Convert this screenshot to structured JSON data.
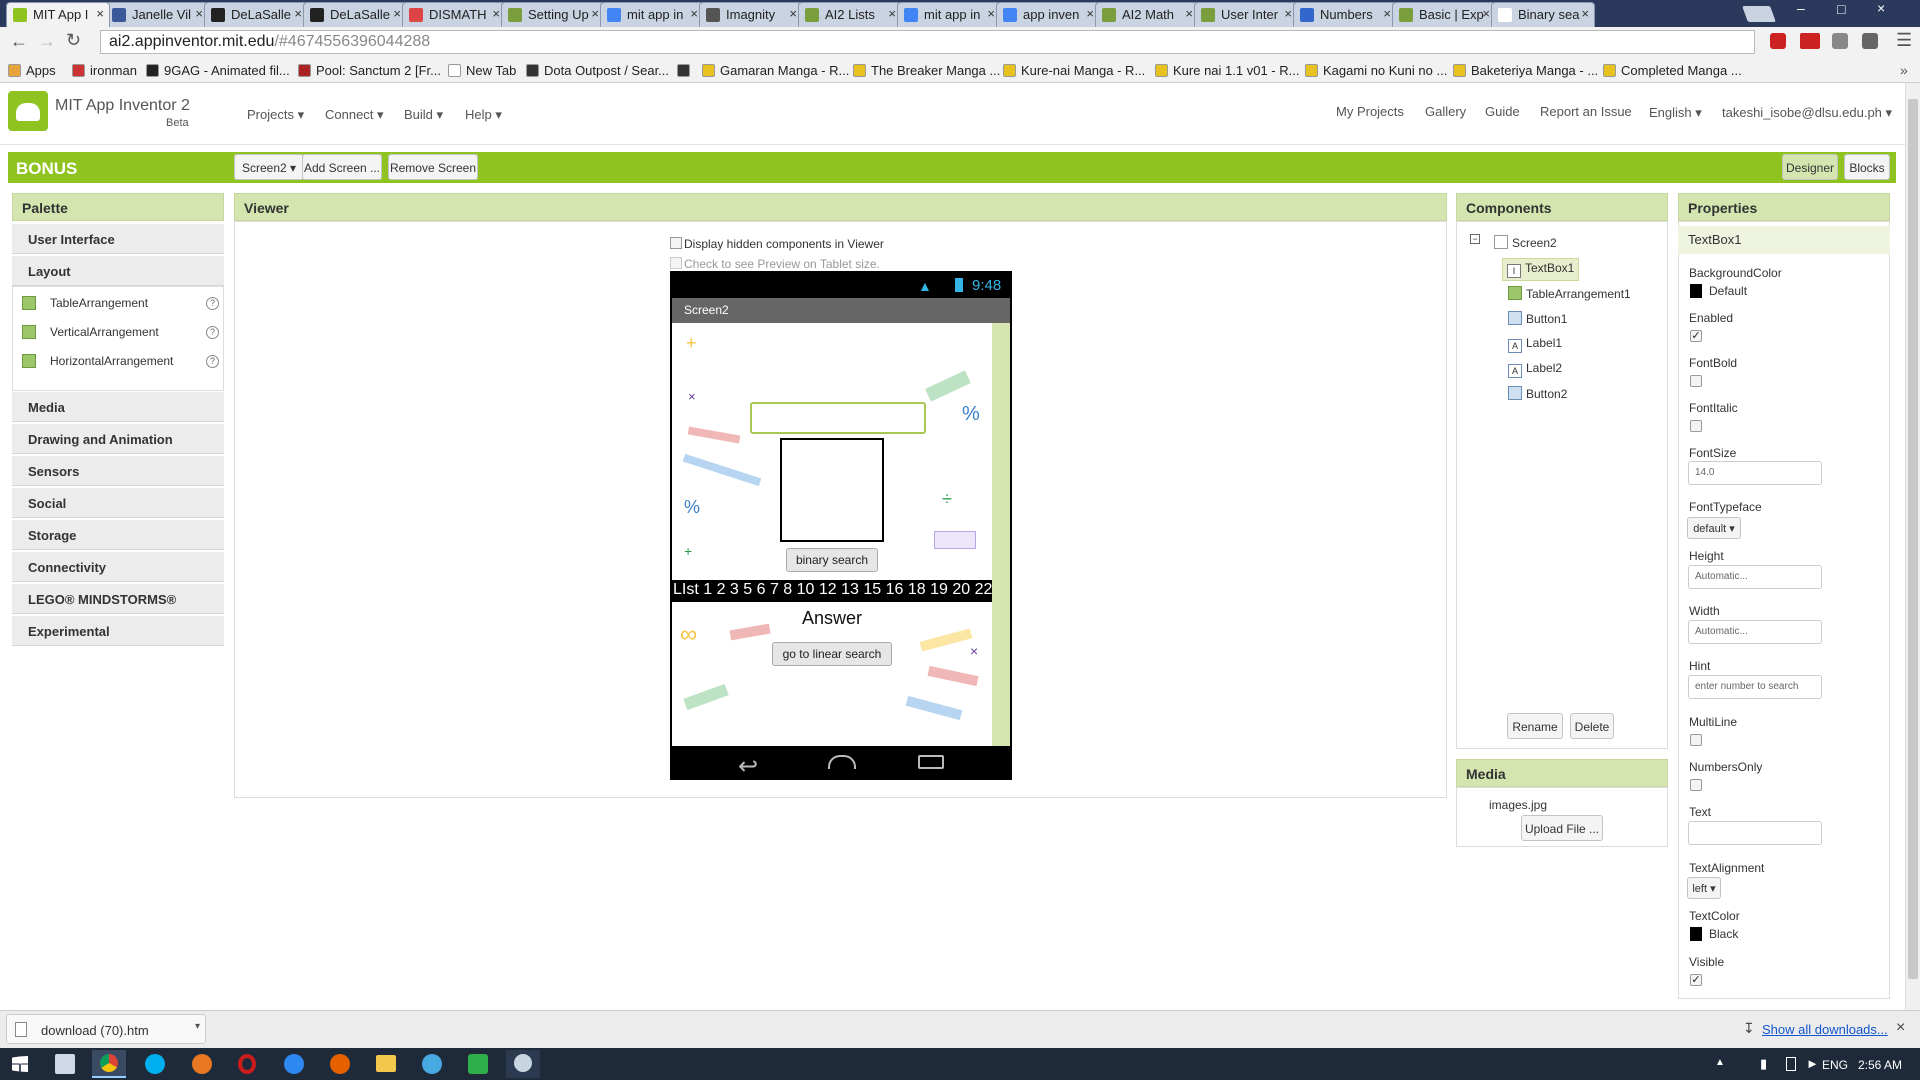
{
  "browser": {
    "tabs": [
      {
        "label": "MIT App I",
        "active": true,
        "fav": "#8fc31f"
      },
      {
        "label": "Janelle Vil",
        "fav": "#3b5998"
      },
      {
        "label": "DeLaSalle",
        "fav": "#222"
      },
      {
        "label": "DeLaSalle",
        "fav": "#222"
      },
      {
        "label": "DISMATH",
        "fav": "#d44"
      },
      {
        "label": "Setting Up",
        "fav": "#7a9e3b"
      },
      {
        "label": "mit app in",
        "fav": "#4285f4"
      },
      {
        "label": "Imagnity",
        "fav": "#555"
      },
      {
        "label": "AI2 Lists",
        "fav": "#7a9e3b"
      },
      {
        "label": "mit app in",
        "fav": "#4285f4"
      },
      {
        "label": "app inven",
        "fav": "#4285f4"
      },
      {
        "label": "AI2 Math",
        "fav": "#7a9e3b"
      },
      {
        "label": "User Inter",
        "fav": "#7a9e3b"
      },
      {
        "label": "Numbers",
        "fav": "#3366cc"
      },
      {
        "label": "Basic | Exp",
        "fav": "#7a9e3b"
      },
      {
        "label": "Binary sea",
        "fav": "#fff"
      }
    ],
    "url_host": "ai2.appinventor.mit.edu",
    "url_path": "/#4674556396044288",
    "bookmarks": [
      {
        "label": "Apps",
        "color": "#e8a33d"
      },
      {
        "label": "ironman",
        "color": "#c33"
      },
      {
        "label": "9GAG - Animated fil...",
        "color": "#222"
      },
      {
        "label": "Pool: Sanctum 2 [Fr...",
        "color": "#a22"
      },
      {
        "label": "New Tab",
        "color": "#fff"
      },
      {
        "label": "Dota Outpost / Sear...",
        "color": "#333"
      },
      {
        "label": "",
        "color": "#333"
      },
      {
        "label": "Gamaran Manga - R...",
        "color": "#e8c21f"
      },
      {
        "label": "The Breaker Manga ...",
        "color": "#e8c21f"
      },
      {
        "label": "Kure-nai Manga - R...",
        "color": "#e8c21f"
      },
      {
        "label": "Kure nai 1.1 v01 - R...",
        "color": "#e8c21f"
      },
      {
        "label": "Kagami no Kuni no ...",
        "color": "#e8c21f"
      },
      {
        "label": "Baketeriya Manga - ...",
        "color": "#e8c21f"
      },
      {
        "label": "Completed Manga ...",
        "color": "#e8c21f"
      }
    ]
  },
  "header": {
    "app_name": "MIT App Inventor 2",
    "beta": "Beta",
    "menus": [
      "Projects ▾",
      "Connect ▾",
      "Build ▾",
      "Help ▾"
    ],
    "right_links": [
      "My Projects",
      "Gallery",
      "Guide",
      "Report an Issue",
      "English ▾",
      "takeshi_isobe@dlsu.edu.ph ▾"
    ]
  },
  "project": {
    "name": "BONUS",
    "screen_select": "Screen2 ▾",
    "add_screen": "Add Screen ...",
    "remove_screen": "Remove Screen",
    "designer": "Designer",
    "blocks": "Blocks"
  },
  "palette": {
    "title": "Palette",
    "categories": [
      "User Interface",
      "Layout",
      "Media",
      "Drawing and Animation",
      "Sensors",
      "Social",
      "Storage",
      "Connectivity",
      "LEGO® MINDSTORMS®",
      "Experimental"
    ],
    "layout_items": [
      "TableArrangement",
      "VerticalArrangement",
      "HorizontalArrangement"
    ]
  },
  "viewer": {
    "title": "Viewer",
    "hidden_label": "Display hidden components in Viewer",
    "tablet_label": "Check to see Preview on Tablet size.",
    "status_time": "9:48",
    "screen_title": "Screen2",
    "button1": "binary search",
    "list_label": "LIst 1 2 3 5 6 7 8 10 12 13 15 16 18 19 20 22",
    "answer": "Answer",
    "button2": "go to linear search"
  },
  "components": {
    "title": "Components",
    "tree": [
      "Screen2",
      "TextBox1",
      "TableArrangement1",
      "Button1",
      "Label1",
      "Label2",
      "Button2"
    ],
    "rename": "Rename",
    "delete": "Delete"
  },
  "media": {
    "title": "Media",
    "file": "images.jpg",
    "upload": "Upload File ..."
  },
  "properties": {
    "title": "Properties",
    "component": "TextBox1",
    "background_color_label": "BackgroundColor",
    "background_color_value": "Default",
    "enabled": "Enabled",
    "font_bold": "FontBold",
    "font_italic": "FontItalic",
    "font_size": "FontSize",
    "font_size_value": "14.0",
    "font_typeface": "FontTypeface",
    "font_typeface_value": "default ▾",
    "height": "Height",
    "height_value": "Automatic...",
    "width": "Width",
    "width_value": "Automatic...",
    "hint": "Hint",
    "hint_value": "enter number to search",
    "multiline": "MultiLine",
    "numbers_only": "NumbersOnly",
    "text": "Text",
    "text_value": "",
    "text_alignment": "TextAlignment",
    "text_alignment_value": "left ▾",
    "text_color": "TextColor",
    "text_color_value": "Black",
    "visible": "Visible"
  },
  "download": {
    "file": "download (70).htm",
    "show_all": "Show all downloads..."
  },
  "system": {
    "lang": "ENG",
    "time": "2:56 AM"
  },
  "colors": {
    "accent": "#8fc31f",
    "panel_head": "#d4e5b0"
  }
}
